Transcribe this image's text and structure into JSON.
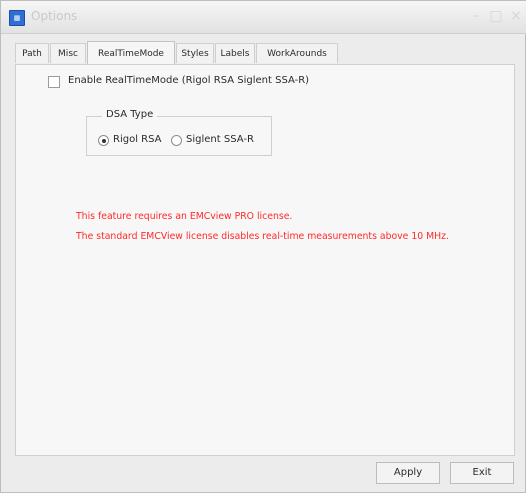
{
  "window": {
    "title": "Options",
    "icon_name": "app-icon",
    "minimize_glyph": "–",
    "maximize_glyph": "□",
    "close_glyph": "×"
  },
  "tabs": [
    {
      "label": "Path",
      "active": false
    },
    {
      "label": "Misc",
      "active": false
    },
    {
      "label": "RealTimeMode",
      "active": true
    },
    {
      "label": "Styles",
      "active": false
    },
    {
      "label": "Labels",
      "active": false
    },
    {
      "label": "WorkArounds",
      "active": false
    }
  ],
  "realtime": {
    "enable_label": "Enable RealTimeMode (Rigol RSA  Siglent SSA-R)",
    "enable_checked": false,
    "dsa_group_title": "DSA Type",
    "options": [
      {
        "label": "Rigol RSA",
        "selected": true
      },
      {
        "label": "Siglent SSA-R",
        "selected": false
      }
    ],
    "warning_line1": "This feature requires an EMCview PRO license.",
    "warning_line2": "The standard EMCView license disables real-time measurements above 10 MHz.",
    "warning_color": "#ff2a2a"
  },
  "footer": {
    "apply_label": "Apply",
    "exit_label": "Exit"
  }
}
